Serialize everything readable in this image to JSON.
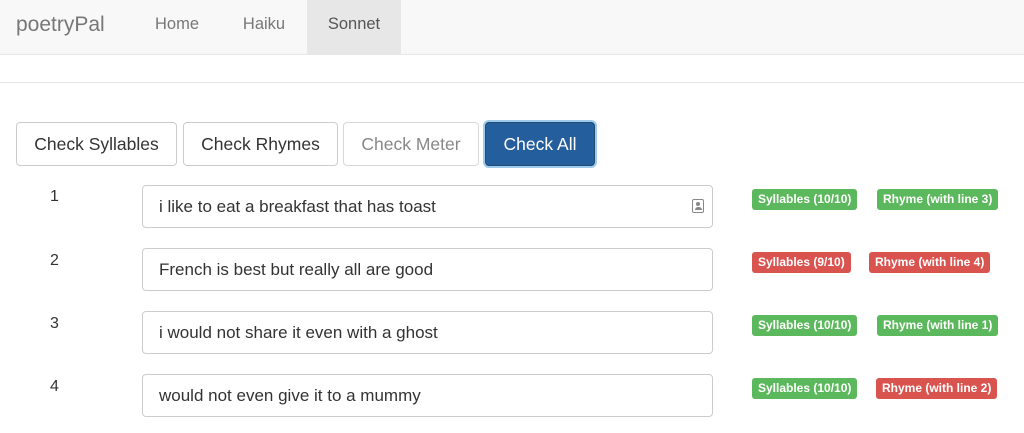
{
  "navbar": {
    "brand": "poetryPal",
    "items": [
      {
        "label": "Home",
        "active": false
      },
      {
        "label": "Haiku",
        "active": false
      },
      {
        "label": "Sonnet",
        "active": true
      }
    ]
  },
  "toolbar": {
    "check_syllables": "Check Syllables",
    "check_rhymes": "Check Rhymes",
    "check_meter": "Check Meter",
    "check_all": "Check All"
  },
  "lines": [
    {
      "number": "1",
      "text": "i like to eat a breakfast that has toast",
      "syllables": {
        "label": "Syllables (10/10)",
        "status": "ok"
      },
      "rhyme": {
        "label": "Rhyme (with line 3)",
        "status": "ok"
      }
    },
    {
      "number": "2",
      "text": "French is best but really all are good",
      "syllables": {
        "label": "Syllables (9/10)",
        "status": "error"
      },
      "rhyme": {
        "label": "Rhyme (with line 4)",
        "status": "error"
      }
    },
    {
      "number": "3",
      "text": "i would not share it even with a ghost",
      "syllables": {
        "label": "Syllables (10/10)",
        "status": "ok"
      },
      "rhyme": {
        "label": "Rhyme (with line 1)",
        "status": "ok"
      }
    },
    {
      "number": "4",
      "text": "would not even give it to a mummy",
      "syllables": {
        "label": "Syllables (10/10)",
        "status": "ok"
      },
      "rhyme": {
        "label": "Rhyme (with line 2)",
        "status": "error"
      }
    }
  ],
  "colors": {
    "ok": "#5cb85c",
    "error": "#d9534f",
    "primary": "#245e9c"
  }
}
